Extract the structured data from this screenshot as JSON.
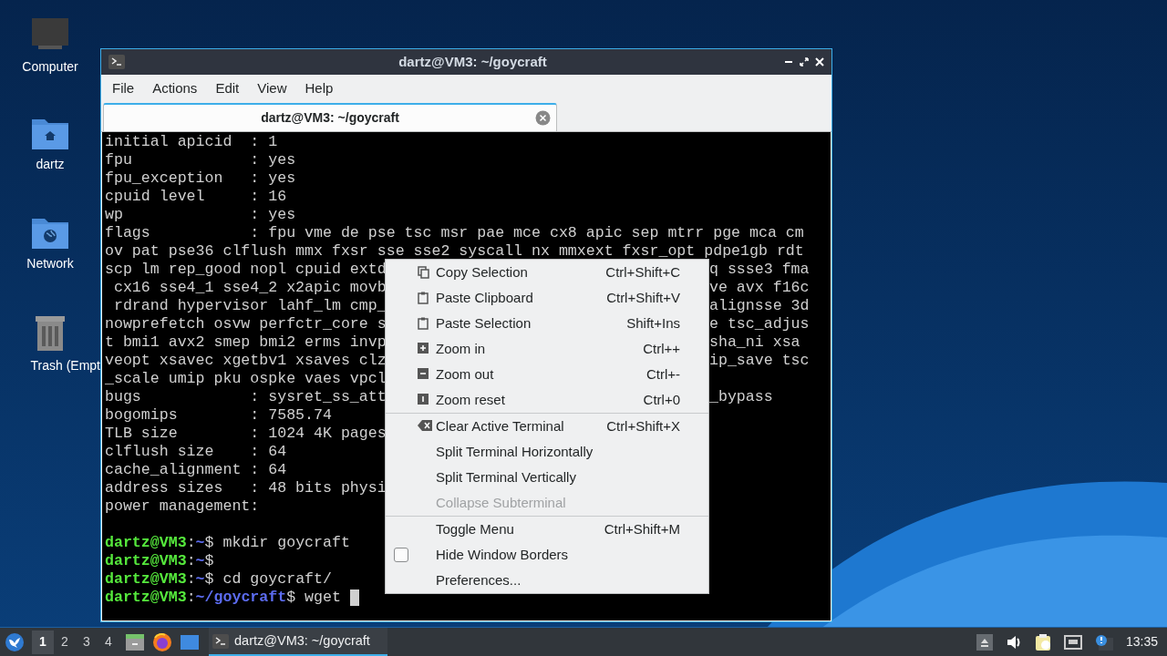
{
  "desktop_icons": [
    {
      "label": "Computer",
      "kind": "computer"
    },
    {
      "label": "dartz",
      "kind": "home"
    },
    {
      "label": "Network",
      "kind": "network"
    },
    {
      "label": "Trash (Empt",
      "kind": "trash"
    }
  ],
  "window": {
    "title": "dartz@VM3: ~/goycraft",
    "menu_bar": [
      "File",
      "Actions",
      "Edit",
      "View",
      "Help"
    ],
    "tabs": [
      {
        "label": "dartz@VM3: ~/goycraft",
        "selected": true
      }
    ],
    "terminal": {
      "lines": [
        {
          "kind": "out",
          "text": "initial apicid  : 1"
        },
        {
          "kind": "out",
          "text": "fpu             : yes"
        },
        {
          "kind": "out",
          "text": "fpu_exception   : yes"
        },
        {
          "kind": "out",
          "text": "cpuid level     : 16"
        },
        {
          "kind": "out",
          "text": "wp              : yes"
        },
        {
          "kind": "out",
          "text": "flags           : fpu vme de pse tsc msr pae mce cx8 apic sep mtrr pge mca cm"
        },
        {
          "kind": "out",
          "text": "ov pat pse36 clflush mmx fxsr sse sse2 syscall nx mmxext fxsr_opt pdpe1gb rdt"
        },
        {
          "kind": "out",
          "text": "scp lm rep_good nopl cpuid extd",
          "right": "q ssse3 fma"
        },
        {
          "kind": "out",
          "text": " cx16 sse4_1 sse4_2 x2apic movb",
          "right": "ve avx f16c"
        },
        {
          "kind": "out",
          "text": " rdrand hypervisor lahf_lm cmp_",
          "right": "alignsse 3d"
        },
        {
          "kind": "out",
          "text": "nowprefetch osvw perfctr_core s",
          "right": "e tsc_adjus"
        },
        {
          "kind": "out",
          "text": "t bmi1 avx2 smep bmi2 erms invp",
          "right": "sha_ni xsa"
        },
        {
          "kind": "out",
          "text": "veopt xsavec xgetbv1 xsaves clz",
          "right": "ip_save tsc"
        },
        {
          "kind": "out",
          "text": "_scale umip pku ospke vaes vpcl"
        },
        {
          "kind": "out",
          "text": "bugs            : sysret_ss_att",
          "right": "_bypass"
        },
        {
          "kind": "out",
          "text": "bogomips        : 7585.74"
        },
        {
          "kind": "out",
          "text": "TLB size        : 1024 4K pages"
        },
        {
          "kind": "out",
          "text": "clflush size    : 64"
        },
        {
          "kind": "out",
          "text": "cache_alignment : 64"
        },
        {
          "kind": "out",
          "text": "address sizes   : 48 bits physi"
        },
        {
          "kind": "out",
          "text": "power management:"
        },
        {
          "kind": "blank"
        },
        {
          "kind": "prompt",
          "user": "dartz@VM3",
          "colon": ":",
          "path": "~",
          "sign": "$",
          "command": "mkdir goycraft"
        },
        {
          "kind": "prompt",
          "user": "dartz@VM3",
          "colon": ":",
          "path": "~",
          "sign": "$"
        },
        {
          "kind": "prompt",
          "user": "dartz@VM3",
          "colon": ":",
          "path": "~",
          "sign": "$",
          "command": "cd goycraft/"
        },
        {
          "kind": "prompt",
          "user": "dartz@VM3",
          "colon": ":",
          "path": "~/goycraft",
          "sign": "$",
          "command": "wget",
          "cursor": true
        }
      ]
    }
  },
  "context_menu": [
    {
      "kind": "item",
      "label": "Copy Selection",
      "shortcut": "Ctrl+Shift+C",
      "disabled": false
    },
    {
      "kind": "item",
      "label": "Paste Clipboard",
      "shortcut": "Ctrl+Shift+V",
      "disabled": false
    },
    {
      "kind": "item",
      "label": "Paste Selection",
      "shortcut": "Shift+Ins",
      "disabled": false
    },
    {
      "kind": "item",
      "label": "Zoom in",
      "shortcut": "Ctrl++",
      "disabled": false
    },
    {
      "kind": "item",
      "label": "Zoom out",
      "shortcut": "Ctrl+-",
      "disabled": false
    },
    {
      "kind": "item",
      "label": "Zoom reset",
      "shortcut": "Ctrl+0",
      "disabled": false
    },
    {
      "kind": "separator"
    },
    {
      "kind": "item",
      "label": "Clear Active Terminal",
      "shortcut": "Ctrl+Shift+X",
      "disabled": false
    },
    {
      "kind": "item",
      "label": "Split Terminal Horizontally",
      "disabled": false
    },
    {
      "kind": "item",
      "label": "Split Terminal Vertically",
      "disabled": false
    },
    {
      "kind": "item",
      "label": "Collapse Subterminal",
      "disabled": true
    },
    {
      "kind": "separator"
    },
    {
      "kind": "item",
      "label": "Toggle Menu",
      "shortcut": "Ctrl+Shift+M",
      "disabled": false
    },
    {
      "kind": "check",
      "label": "Hide Window Borders",
      "checked": false
    },
    {
      "kind": "item",
      "label": "Preferences...",
      "disabled": false
    }
  ],
  "taskbar": {
    "workspaces": [
      {
        "label": "1",
        "selected": true
      },
      {
        "label": "2",
        "selected": false
      },
      {
        "label": "3",
        "selected": false
      },
      {
        "label": "4",
        "selected": false
      }
    ],
    "tasks": [
      {
        "label": "dartz@VM3: ~/goycraft",
        "selected": true
      }
    ],
    "clock": "13:35"
  }
}
